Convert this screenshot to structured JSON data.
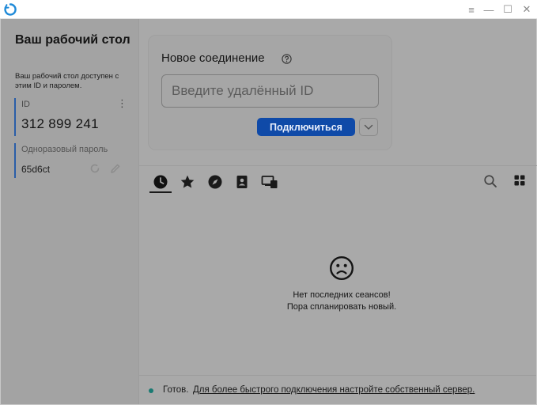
{
  "window": {
    "minimize_glyph": "—",
    "menu_glyph": "≡",
    "maximize_glyph": "☐",
    "close_glyph": "✕"
  },
  "sidebar": {
    "title": "Ваш рабочий стол",
    "description": "Ваш рабочий стол доступен с этим ID и паролем.",
    "id_label": "ID",
    "id_value": "312 899 241",
    "password_label": "Одноразовый пароль",
    "password_value": "65d6ct"
  },
  "connection": {
    "title": "Новое соединение",
    "input_placeholder": "Введите удалённый ID",
    "connect_label": "Подключиться"
  },
  "tabs": [
    {
      "name": "recent",
      "icon": "clock-icon",
      "active": true
    },
    {
      "name": "favorites",
      "icon": "star-icon",
      "active": false
    },
    {
      "name": "discovered",
      "icon": "compass-icon",
      "active": false
    },
    {
      "name": "address-book",
      "icon": "address-book-icon",
      "active": false
    },
    {
      "name": "group",
      "icon": "devices-icon",
      "active": false
    }
  ],
  "empty_state": {
    "line1": "Нет последних сеансов!",
    "line2": "Пора спланировать новый."
  },
  "status": {
    "ready": "Готов.",
    "link": "Для более быстрого подключения настройте собственный сервер."
  },
  "colors": {
    "accent": "#0f4aa8",
    "status_ok": "#1a7a72"
  }
}
